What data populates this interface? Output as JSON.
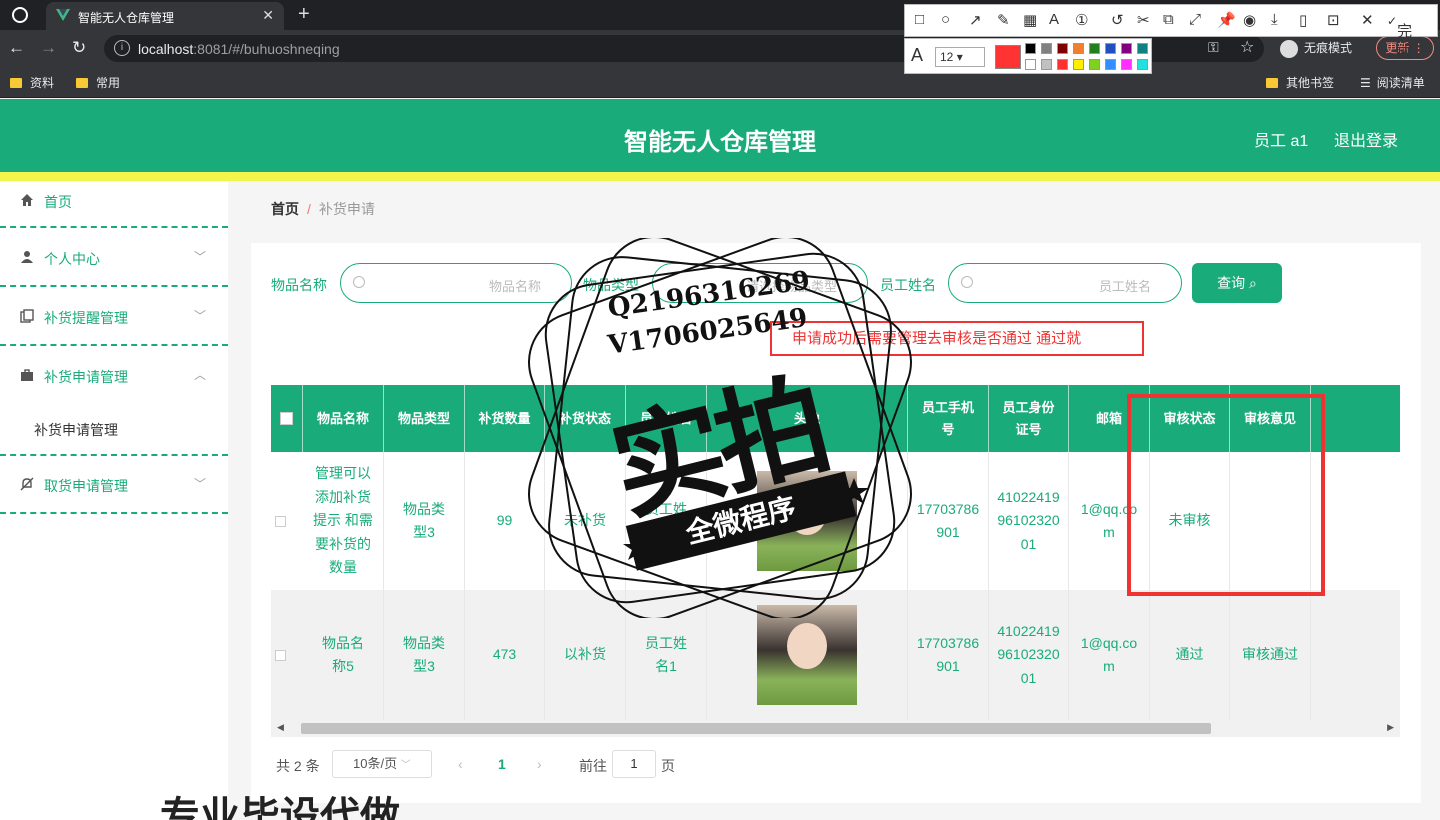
{
  "browser": {
    "tab_title": "智能无人仓库管理",
    "url_host": "localhost",
    "url_rest": ":8081/#/buhuoshneqing",
    "bookmarks": [
      "资料",
      "常用"
    ],
    "bookmarks_right": [
      "其他书签",
      "阅读清单"
    ],
    "incognito_label": "无痕模式",
    "update_label": "更新",
    "snip_done": "完成",
    "snip_font_size": "12"
  },
  "header": {
    "title": "智能无人仓库管理",
    "user": "员工 a1",
    "logout": "退出登录",
    "colors": {
      "primary": "#1aab7a",
      "accent_bar": "#f2f64b"
    }
  },
  "sidebar": {
    "items": [
      {
        "label": "首页",
        "icon": "home-icon"
      },
      {
        "label": "个人中心",
        "icon": "user-icon"
      },
      {
        "label": "补货提醒管理",
        "icon": "copy-icon"
      },
      {
        "label": "补货申请管理",
        "icon": "briefcase-icon"
      },
      {
        "label": "取货申请管理",
        "icon": "bell-off-icon"
      }
    ],
    "sub_item": "补货申请管理"
  },
  "breadcrumb": {
    "home": "首页",
    "sep": "/",
    "current": "补货申请"
  },
  "filters": {
    "item_name": {
      "label": "物品名称",
      "placeholder": "物品名称"
    },
    "item_type": {
      "label": "物品类型",
      "placeholder": "请选择物品类型"
    },
    "staff_name": {
      "label": "员工姓名",
      "placeholder": "员工姓名"
    },
    "query_button": "查询"
  },
  "annotation_note": "申请成功后需要管理去审核是否通过 通过就",
  "table": {
    "headers": [
      "物品名称",
      "物品类型",
      "补货数量",
      "补货状态",
      "员工姓名",
      "头像",
      "员工手机号",
      "员工身份证号",
      "邮箱",
      "审核状态",
      "审核意见"
    ],
    "rows": [
      {
        "name": "管理可以添加补货提示 和需要补货的数量",
        "type": "物品类型3",
        "qty": "99",
        "status": "未补货",
        "staff": "员工姓名1",
        "phone": "17703786901",
        "idcard": "410224199610232001",
        "email": "1@qq.com",
        "audit": "未审核",
        "opinion": ""
      },
      {
        "name": "物品名称5",
        "type": "物品类型3",
        "qty": "473",
        "status": "以补货",
        "staff": "员工姓名1",
        "phone": "17703786901",
        "idcard": "410224199610232001",
        "email": "1@qq.com",
        "audit": "通过",
        "opinion": "审核通过"
      }
    ]
  },
  "pagination": {
    "total": "共 2 条",
    "page_size": "10条/页",
    "current_page": "1",
    "goto_label": "前往",
    "goto_value": "1",
    "page_unit": "页"
  },
  "watermark": {
    "qq": "Q2196316269",
    "vx": "V1706025649",
    "big": "实拍",
    "ribbon": "全微程序",
    "bottom": "专业毕设代做"
  }
}
